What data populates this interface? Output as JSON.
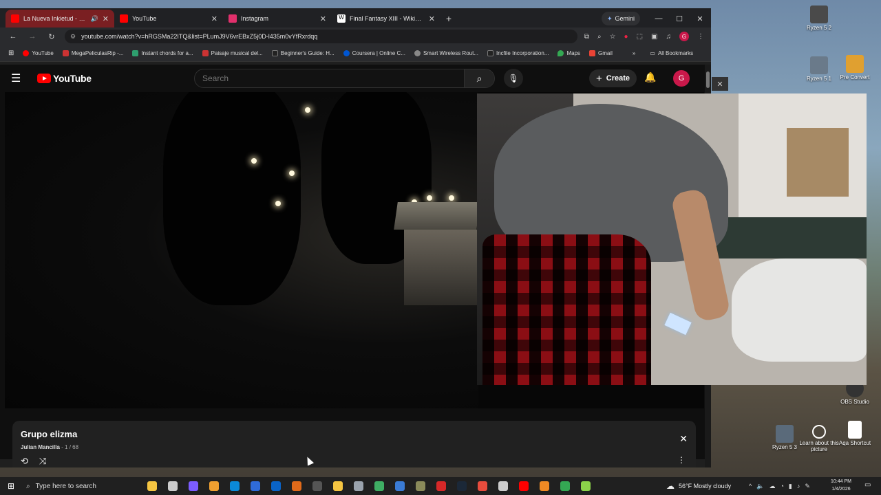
{
  "desktop": {
    "icons": [
      {
        "label": "Ryzen 5 2",
        "color": "#4a4a4a"
      },
      {
        "label": "Ryzen 5 1",
        "color": "#6a7a8a"
      },
      {
        "label": "Pre Convert",
        "color": "#e0a030"
      },
      {
        "label": "OBS Studio",
        "color": "#333333"
      },
      {
        "label": "Ryzen 5 3",
        "color": "#5a6a7a"
      },
      {
        "label": "Learn about this picture",
        "color": "#444444"
      },
      {
        "label": "Aqa Shortcut",
        "color": "#ffffff"
      }
    ]
  },
  "browser": {
    "tabs": [
      {
        "title": "La Nueva Inkietud - Ramon",
        "favicon_color": "#ff0000",
        "active": true,
        "audio": true
      },
      {
        "title": "YouTube",
        "favicon_color": "#ff0000",
        "active": false,
        "audio": false
      },
      {
        "title": "Instagram",
        "favicon_color": "#e1306c",
        "active": false,
        "audio": false
      },
      {
        "title": "Final Fantasy XIII - Wikipedia",
        "favicon_color": "#ffffff",
        "active": false,
        "audio": false
      }
    ],
    "gemini_label": "Gemini",
    "url": "youtube.com/watch?v=hRGSMa22ITQ&list=PLumJ9V6vrEBxZ5j0D-l435m0vYfRxrdqq",
    "bookmarks": [
      {
        "label": "YouTube",
        "color": "#ff0000"
      },
      {
        "label": "MegaPeliculasRip -...",
        "color": "#cc3333"
      },
      {
        "label": "Instant chords for a...",
        "color": "#2e9e6e"
      },
      {
        "label": "Paisaje musical del...",
        "color": "#c33"
      },
      {
        "label": "Beginner's Guide: H...",
        "color": "#222222"
      },
      {
        "label": "Coursera | Online C...",
        "color": "#0056d2"
      },
      {
        "label": "Smart Wireless Rout...",
        "color": "#888888"
      },
      {
        "label": "Incfile Incorporation...",
        "color": "#222222"
      },
      {
        "label": "Maps",
        "color": "#34a853"
      },
      {
        "label": "Gmail",
        "color": "#ea4335"
      }
    ],
    "all_bookmarks": "All Bookmarks"
  },
  "youtube": {
    "logo_text": "YouTube",
    "search_placeholder": "Search",
    "create_label": "Create",
    "avatar_letter": "G",
    "playlist": {
      "title": "Grupo elizma",
      "owner": "Julian Mancilla",
      "position": "1 / 68"
    }
  },
  "taskbar": {
    "search_placeholder": "Type here to search",
    "apps": [
      {
        "name": "copilot",
        "color": "#f5c542"
      },
      {
        "name": "task-view",
        "color": "#cccccc"
      },
      {
        "name": "cortana",
        "color": "#7b5cff"
      },
      {
        "name": "media",
        "color": "#f0a030"
      },
      {
        "name": "edge",
        "color": "#0b8ad8"
      },
      {
        "name": "app",
        "color": "#2f6bd8"
      },
      {
        "name": "outlook",
        "color": "#0a64c8"
      },
      {
        "name": "firefox",
        "color": "#e06a1a"
      },
      {
        "name": "app2",
        "color": "#555555"
      },
      {
        "name": "file-explorer",
        "color": "#f5c542"
      },
      {
        "name": "app3",
        "color": "#9aa3ad"
      },
      {
        "name": "app4",
        "color": "#3fae64"
      },
      {
        "name": "calculator",
        "color": "#3a7bd5"
      },
      {
        "name": "app5",
        "color": "#8a8a5a"
      },
      {
        "name": "app6",
        "color": "#d62828"
      },
      {
        "name": "steam",
        "color": "#1b2838"
      },
      {
        "name": "chrome",
        "color": "#e84c3d"
      },
      {
        "name": "app7",
        "color": "#cccccc"
      },
      {
        "name": "youtube",
        "color": "#ff0000"
      },
      {
        "name": "vlc",
        "color": "#f08a24"
      },
      {
        "name": "chrome2",
        "color": "#34a853"
      },
      {
        "name": "app8",
        "color": "#8bd34a"
      }
    ],
    "weather_text": "56°F  Mostly cloudy",
    "time": "10:44 PM",
    "date": "1/4/2026"
  }
}
